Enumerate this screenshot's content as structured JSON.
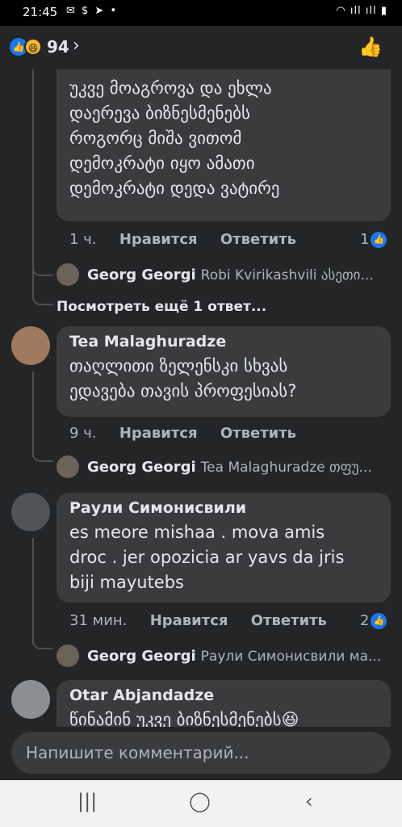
{
  "status": {
    "time": "21:45",
    "icons_left": "✉ $ ➤ •",
    "icons_right": "◠ ıll ıll ▮"
  },
  "header": {
    "like_glyph": "👍",
    "haha_glyph": "😆",
    "reaction_count": "94",
    "chevron": "›",
    "thumb_glyph": "👍"
  },
  "comments": [
    {
      "text": "უკვე მოაგროვა და ეხლა\nდაერევა ბიზნესმენებს\nროგორც მიშა ვითომ\nდემოკრატი იყო ამათი\nდემოკრატი დედა ვატირე",
      "time": "1 ч.",
      "like": "Нравится",
      "reply": "Ответить",
      "likes": "1",
      "replies": [
        {
          "name": "Georg Georgi",
          "text": "Robi Kvirikashvili ასეთი..."
        }
      ],
      "view_more": "Посмотреть ещё 1 ответ..."
    },
    {
      "name": "Tea Malaghuradze",
      "text": "თაღლითი ზელენსკი სხვას\nედავება თავის პროფესიას?",
      "time": "9 ч.",
      "like": "Нравится",
      "reply": "Ответить",
      "replies": [
        {
          "name": "Georg Georgi",
          "text": "Tea Malaghuradze თფუ..."
        }
      ]
    },
    {
      "name": "Раули Симонисвили",
      "text": "es meore mishaa . mova amis\ndroc . jer opozicia ar yavs da jris\nbiji mayutebs",
      "time": "31 мин.",
      "like": "Нравится",
      "reply": "Ответить",
      "likes": "2",
      "replies": [
        {
          "name": "Georg Georgi",
          "text": "Раули Симонисвили ма..."
        }
      ]
    },
    {
      "name": "Otar Abjandadze",
      "text": "წინამინ უკვე ბიზნესმენებს😆"
    }
  ],
  "composer": {
    "placeholder": "Напишите комментарий..."
  },
  "nav": {
    "recent": "|||",
    "home": "◯",
    "back": "‹"
  }
}
